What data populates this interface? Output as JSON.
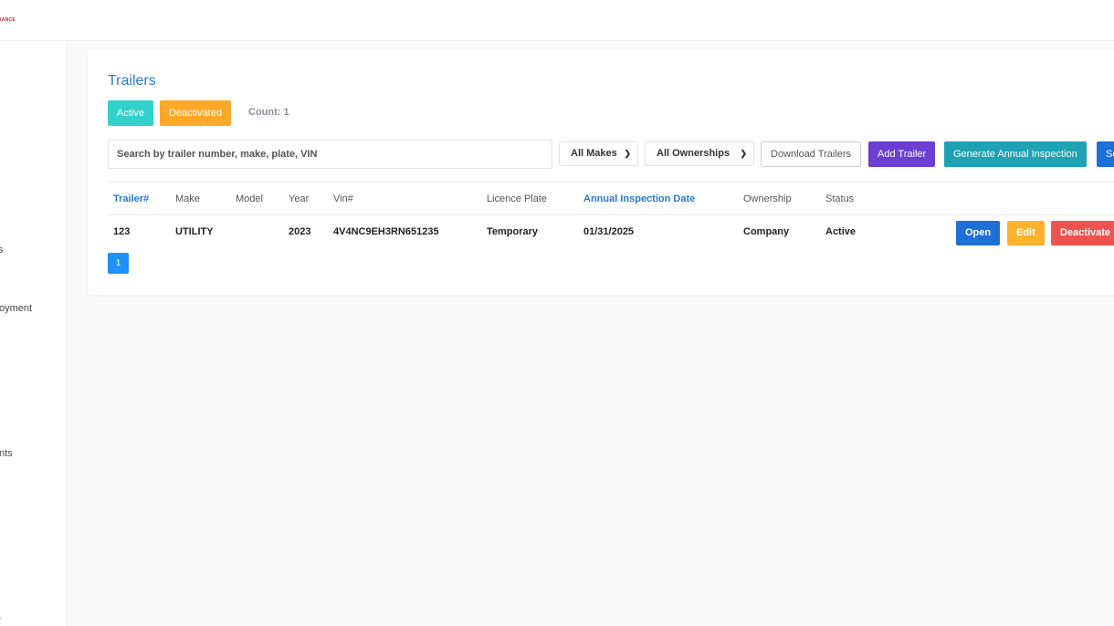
{
  "app": {
    "brand": "IANCE"
  },
  "sidebar": {
    "items": [
      {
        "label": "s"
      },
      {
        "label": "oyment"
      },
      {
        "label": "nts"
      },
      {
        "label": "r"
      }
    ]
  },
  "page": {
    "title": "Trailers",
    "filters": {
      "active_label": "Active",
      "deactivated_label": "Deactivated",
      "count_text": "Count: 1"
    },
    "search": {
      "placeholder": "Search by trailer number, make, plate, VIN"
    },
    "selects": {
      "makes": "All Makes",
      "ownerships": "All Ownerships"
    },
    "actions": {
      "download": "Download Trailers",
      "add": "Add Trailer",
      "annual": "Generate Annual Inspection",
      "extra": "Sc"
    },
    "table": {
      "headers": [
        "Trailer#",
        "Make",
        "Model",
        "Year",
        "Vin#",
        "Licence Plate",
        "Annual Inspection Date",
        "Ownership",
        "Status"
      ],
      "rows": [
        {
          "trailer": "123",
          "make": "UTILITY",
          "model": "",
          "year": "2023",
          "vin": "4V4NC9EH3RN651235",
          "plate": "Temporary",
          "inspection": "01/31/2025",
          "ownership": "Company",
          "status": "Active"
        }
      ],
      "row_actions": {
        "open": "Open",
        "edit": "Edit",
        "deactivate": "Deactivate"
      }
    },
    "pagination": {
      "current": "1"
    }
  },
  "colors": {
    "title": "#2878d4",
    "active_chip": "#33d1cc",
    "deactivated_chip": "#ffa726",
    "add_button": "#6a3fd1",
    "annual_button": "#1ea2b4",
    "open_button": "#1e6fd6",
    "edit_button": "#ffb22e",
    "deactivate_button": "#ef5350"
  }
}
